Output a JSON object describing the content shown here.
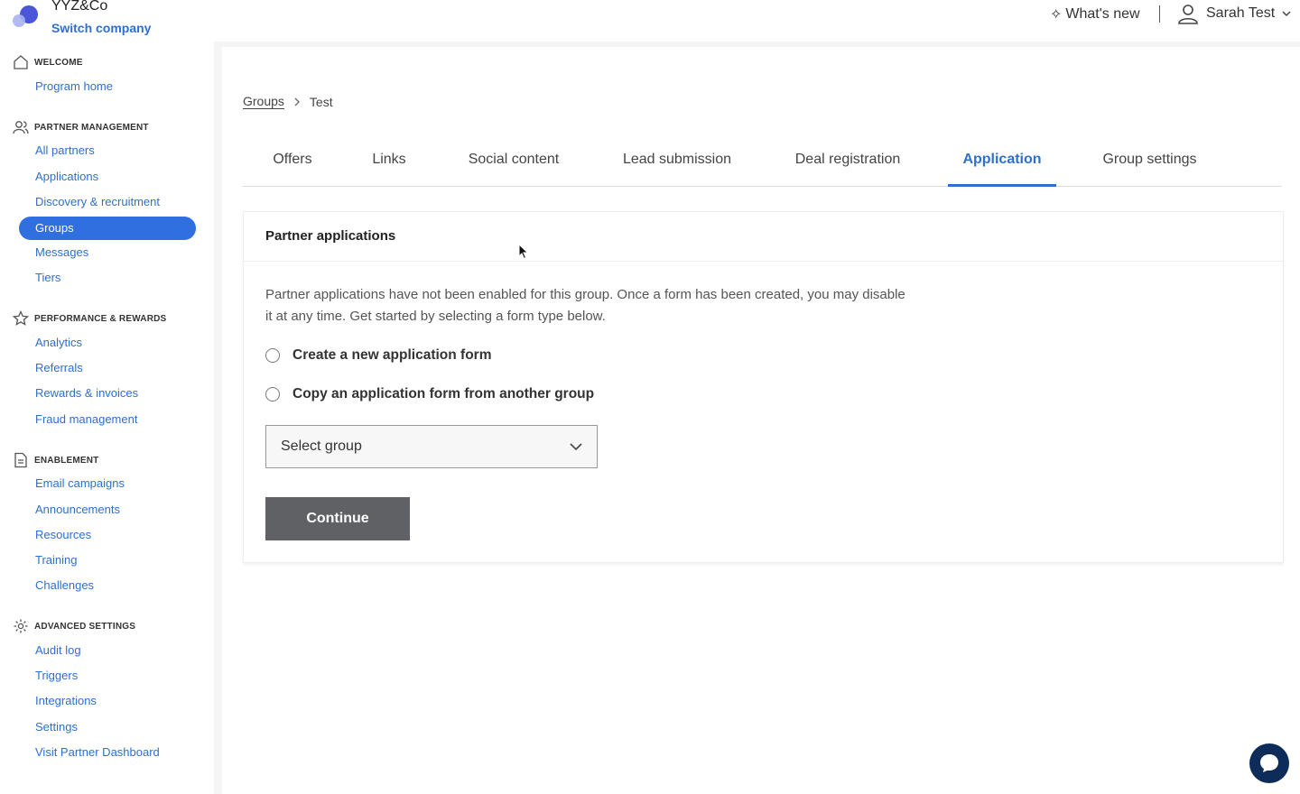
{
  "header": {
    "company_name": "YYZ&Co",
    "switch_company": "Switch company",
    "whats_new": "What's new",
    "user_name": "Sarah Test"
  },
  "sidebar": {
    "sections": [
      {
        "title": "WELCOME",
        "icon": "home-icon",
        "items": [
          "Program home"
        ]
      },
      {
        "title": "PARTNER MANAGEMENT",
        "icon": "users-icon",
        "items": [
          "All partners",
          "Applications",
          "Discovery & recruitment",
          "Groups",
          "Messages",
          "Tiers"
        ]
      },
      {
        "title": "PERFORMANCE & REWARDS",
        "icon": "star-icon",
        "items": [
          "Analytics",
          "Referrals",
          "Rewards & invoices",
          "Fraud management"
        ]
      },
      {
        "title": "ENABLEMENT",
        "icon": "document-icon",
        "items": [
          "Email campaigns",
          "Announcements",
          "Resources",
          "Training",
          "Challenges"
        ]
      },
      {
        "title": "ADVANCED SETTINGS",
        "icon": "gear-icon",
        "items": [
          "Audit log",
          "Triggers",
          "Integrations",
          "Settings",
          "Visit Partner Dashboard"
        ]
      }
    ],
    "active_item": "Groups"
  },
  "breadcrumb": {
    "parent": "Groups",
    "current": "Test"
  },
  "tabs": [
    "Offers",
    "Links",
    "Social content",
    "Lead submission",
    "Deal registration",
    "Application",
    "Group settings"
  ],
  "active_tab": "Application",
  "panel": {
    "title": "Partner applications",
    "description": "Partner applications have not been enabled for this group. Once a form has been created, you may disable it at any time. Get started by selecting a form type below.",
    "options": [
      "Create a new application form",
      "Copy an application form from another group"
    ],
    "select_placeholder": "Select group",
    "continue_label": "Continue"
  },
  "colors": {
    "accent": "#2f6fcf",
    "active_nav": "#2f6fe0",
    "continue_button": "#5f6164",
    "chat_button": "#0e2c5a"
  }
}
